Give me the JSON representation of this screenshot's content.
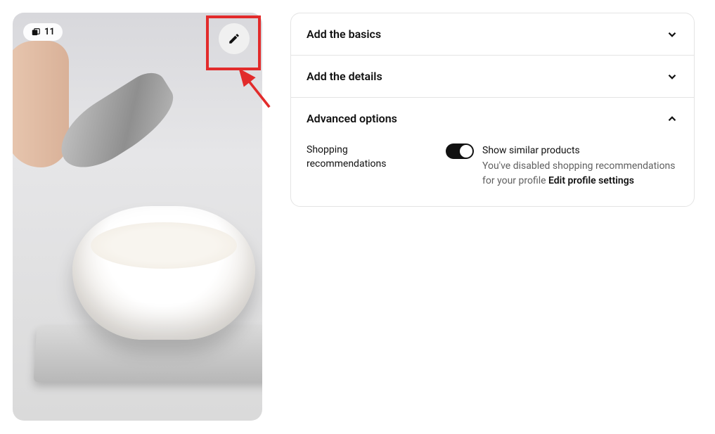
{
  "image": {
    "count_badge": "11"
  },
  "sections": {
    "basics": {
      "title": "Add the basics"
    },
    "details": {
      "title": "Add the details"
    },
    "advanced": {
      "title": "Advanced options",
      "shopping": {
        "label": "Shopping recommendations",
        "toggle_title": "Show similar products",
        "toggle_desc_prefix": "You've disabled shopping recommendations for your profile ",
        "toggle_link": "Edit profile settings"
      }
    }
  },
  "annotation": {
    "highlight_color": "#e22b2b"
  }
}
